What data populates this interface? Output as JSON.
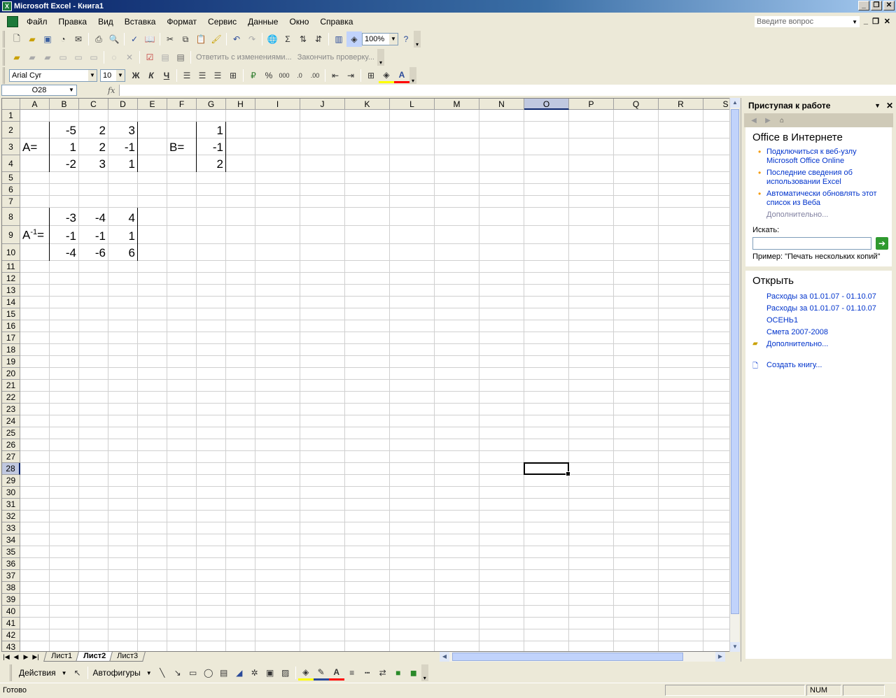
{
  "window": {
    "title": "Microsoft Excel - Книга1",
    "app_icon_letter": "X"
  },
  "menu": {
    "items": [
      "Файл",
      "Правка",
      "Вид",
      "Вставка",
      "Формат",
      "Сервис",
      "Данные",
      "Окно",
      "Справка"
    ],
    "ask_placeholder": "Введите вопрос"
  },
  "toolbar": {
    "zoom": "100%",
    "font_name": "Arial Cyr",
    "font_size": "10",
    "bold": "Ж",
    "italic": "К",
    "underline": "Ч",
    "percent": "%",
    "thousands": "000",
    "reply_changes": "Ответить с изменениями...",
    "end_review": "Закончить проверку..."
  },
  "formula_bar": {
    "name_box": "O28",
    "fx": "fx",
    "content": ""
  },
  "grid": {
    "columns": [
      "A",
      "B",
      "C",
      "D",
      "E",
      "F",
      "G",
      "H",
      "I",
      "J",
      "K",
      "L",
      "M",
      "N",
      "O",
      "P",
      "Q",
      "R",
      "S"
    ],
    "rows": [
      "1",
      "2",
      "3",
      "4",
      "5",
      "6",
      "7",
      "8",
      "9",
      "10",
      "11",
      "12",
      "13",
      "14",
      "15",
      "16",
      "17",
      "18",
      "19",
      "20",
      "21",
      "22",
      "23",
      "24",
      "25",
      "26",
      "27",
      "28",
      "29",
      "30",
      "31",
      "32",
      "33",
      "34",
      "35",
      "36",
      "37",
      "38",
      "39",
      "40",
      "41",
      "42",
      "43"
    ],
    "selected_column": "O",
    "selected_row": "28",
    "cells": {
      "B2": "-5",
      "C2": "2",
      "D2": "3",
      "G2": "1",
      "A3": "A=",
      "B3": "1",
      "C3": "2",
      "D3": "-1",
      "F3": "B=",
      "G3": "-1",
      "B4": "-2",
      "C4": "3",
      "D4": "1",
      "G4": "2",
      "B8": "-3",
      "C8": "-4",
      "D8": "4",
      "A9_base": "A",
      "A9_sup": "-1",
      "A9_eq": "=",
      "B9": "-1",
      "C9": "-1",
      "D9": "1",
      "B10": "-4",
      "C10": "-6",
      "D10": "6"
    }
  },
  "sheets": {
    "tabs": [
      "Лист1",
      "Лист2",
      "Лист3"
    ],
    "active": "Лист2"
  },
  "task_pane": {
    "title": "Приступая к работе",
    "section_online": "Office в Интернете",
    "online_links": [
      "Подключиться к веб-узлу Microsoft Office Online",
      "Последние сведения об использовании Excel",
      "Автоматически обновлять этот список из Веба"
    ],
    "more": "Дополнительно...",
    "search_label": "Искать:",
    "example": "Пример:  \"Печать нескольких копий\"",
    "section_open": "Открыть",
    "recent_files": [
      "Расходы за 01.01.07 - 01.10.07",
      "Расходы за 01.01.07 - 01.10.07",
      "ОСЕНЬ1",
      "Смета 2007-2008"
    ],
    "open_more": "Дополнительно...",
    "create": "Создать книгу..."
  },
  "drawing": {
    "actions": "Действия",
    "autoshapes": "Автофигуры"
  },
  "status": {
    "ready": "Готово",
    "num": "NUM"
  }
}
